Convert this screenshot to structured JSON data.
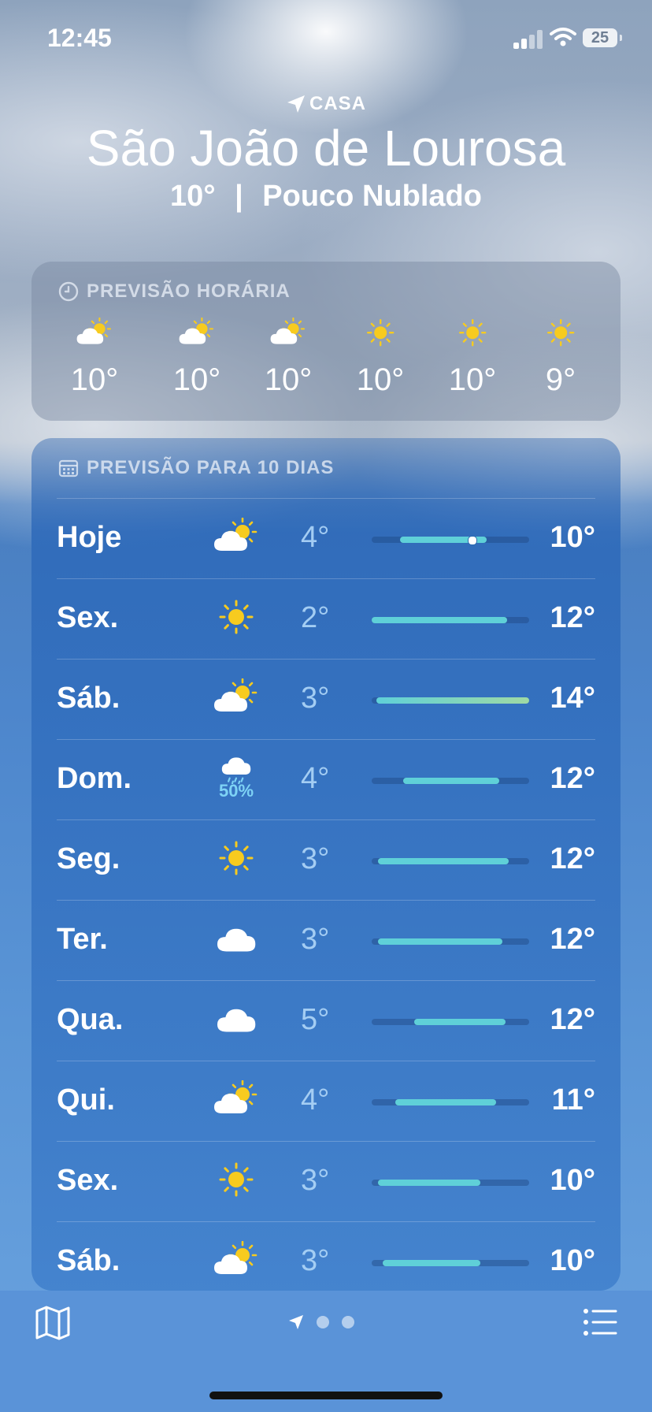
{
  "status": {
    "time": "12:45",
    "battery": "25"
  },
  "header": {
    "location_label": "CASA",
    "city": "São João de Lourosa",
    "summary_temp": "10°",
    "summary_sep": "|",
    "summary_condition": "Pouco Nublado"
  },
  "hourly": {
    "title": "PREVISÃO HORÁRIA",
    "items": [
      {
        "icon": "partly-cloudy-icon",
        "temp": "10°"
      },
      {
        "icon": "partly-cloudy-icon",
        "temp": "10°"
      },
      {
        "icon": "partly-cloudy-icon",
        "temp": "10°"
      },
      {
        "icon": "sun-icon",
        "temp": "10°"
      },
      {
        "icon": "sun-icon",
        "temp": "10°"
      },
      {
        "icon": "sun-icon",
        "temp": "9°"
      }
    ]
  },
  "daily": {
    "title": "PREVISÃO PARA 10 DIAS",
    "items": [
      {
        "day": "Hoje",
        "icon": "partly-cloudy-icon",
        "low": "4°",
        "high": "10°",
        "range_start": 0.18,
        "range_end": 0.73,
        "current": 0.64
      },
      {
        "day": "Sex.",
        "icon": "sun-icon",
        "low": "2°",
        "high": "12°",
        "range_start": 0.0,
        "range_end": 0.86
      },
      {
        "day": "Sáb.",
        "icon": "partly-cloudy-icon",
        "low": "3°",
        "high": "14°",
        "range_start": 0.03,
        "range_end": 1.0
      },
      {
        "day": "Dom.",
        "icon": "rain-cloud-icon",
        "precip": "50%",
        "low": "4°",
        "high": "12°",
        "range_start": 0.2,
        "range_end": 0.81
      },
      {
        "day": "Seg.",
        "icon": "sun-icon",
        "low": "3°",
        "high": "12°",
        "range_start": 0.04,
        "range_end": 0.87
      },
      {
        "day": "Ter.",
        "icon": "cloud-icon",
        "low": "3°",
        "high": "12°",
        "range_start": 0.04,
        "range_end": 0.83
      },
      {
        "day": "Qua.",
        "icon": "cloud-icon",
        "low": "5°",
        "high": "12°",
        "range_start": 0.27,
        "range_end": 0.85
      },
      {
        "day": "Qui.",
        "icon": "partly-cloudy-icon",
        "low": "4°",
        "high": "11°",
        "range_start": 0.15,
        "range_end": 0.79
      },
      {
        "day": "Sex.",
        "icon": "sun-icon",
        "low": "3°",
        "high": "10°",
        "range_start": 0.04,
        "range_end": 0.69
      },
      {
        "day": "Sáb.",
        "icon": "partly-cloudy-icon",
        "low": "3°",
        "high": "10°",
        "range_start": 0.07,
        "range_end": 0.69
      }
    ]
  },
  "colors": {
    "sun": "#f7cb1f",
    "range_bar": "#5fd0d8",
    "precip": "#7ed3f5",
    "toolbar": "#5a93d8"
  },
  "toolbar": {
    "map_icon": "map-icon",
    "list_icon": "list-icon"
  }
}
